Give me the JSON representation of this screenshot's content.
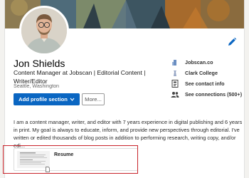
{
  "profile": {
    "name": "Jon Shields",
    "headline": "Content Manager at Jobscan | Editorial Content | Writer/Editor",
    "location": "Seattle, Washington"
  },
  "actions": {
    "add_section_label": "Add profile section",
    "more_label": "More..."
  },
  "info": {
    "company": "Jobscan.co",
    "school": "Clark College",
    "contact": "See contact info",
    "connections": "See connections (500+)"
  },
  "about": {
    "text": "I am a content manager, writer, and editor with 7 years experience in digital publishing and 6 years in print. My goal is always to educate, inform, and provide new perspectives through editorial. I've written or edited thousands of blog posts in addition to performing research, writing copy, and/or edi..."
  },
  "media": {
    "title": "Resume"
  },
  "colors": {
    "primary": "#0a66c2",
    "highlight": "#c8232b"
  }
}
